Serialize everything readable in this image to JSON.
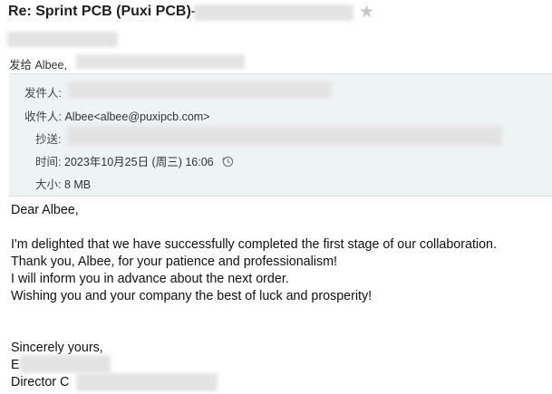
{
  "email": {
    "subject": "Re: Sprint PCB (Puxi PCB)-",
    "to_line_label": "发给 Albee,",
    "header": {
      "from_label": "发件人:",
      "to_label": "收件人:",
      "to_value": "Albee<albee@puxipcb.com>",
      "cc_label": "抄送:",
      "time_label": "时间:",
      "time_value": "2023年10月25日 (周三) 16:06",
      "size_label": "大小:",
      "size_value": "8 MB"
    },
    "body": {
      "greeting": "Dear Albee,",
      "lines": [
        "I'm delighted that we have successfully completed the first stage of our collaboration.",
        "Thank you, Albee, for your patience and professionalism!",
        "I will inform you in advance about the next order.",
        "Wishing you and your company the best of luck and prosperity!"
      ],
      "closing": "Sincerely yours,",
      "signature_line1": "E",
      "signature_line2": "Director C"
    }
  },
  "icons": {
    "star": "star-icon",
    "clock": "clock-icon"
  },
  "colors": {
    "header_bg": "#eef3f4",
    "star": "#c7c7c7"
  }
}
